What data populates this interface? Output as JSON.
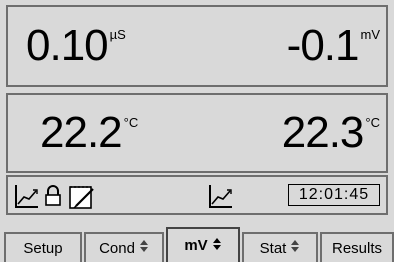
{
  "readings": {
    "conductivity": {
      "value": "0.10",
      "unit": "µS"
    },
    "millivolts": {
      "value": "-0.1",
      "unit": "mV"
    },
    "temp_left": {
      "value": "22.2",
      "unit": "°C"
    },
    "temp_right": {
      "value": "22.3",
      "unit": "°C"
    }
  },
  "status": {
    "clock": "12:01:45",
    "icons": [
      "chart-icon",
      "lock-icon",
      "notepad-icon",
      "chart-icon"
    ]
  },
  "tabs": [
    {
      "label": "Setup",
      "updown": false,
      "active": false
    },
    {
      "label": "Cond",
      "updown": true,
      "active": false
    },
    {
      "label": "mV",
      "updown": true,
      "active": true
    },
    {
      "label": "Stat",
      "updown": true,
      "active": false
    },
    {
      "label": "Results",
      "updown": false,
      "active": false
    }
  ]
}
